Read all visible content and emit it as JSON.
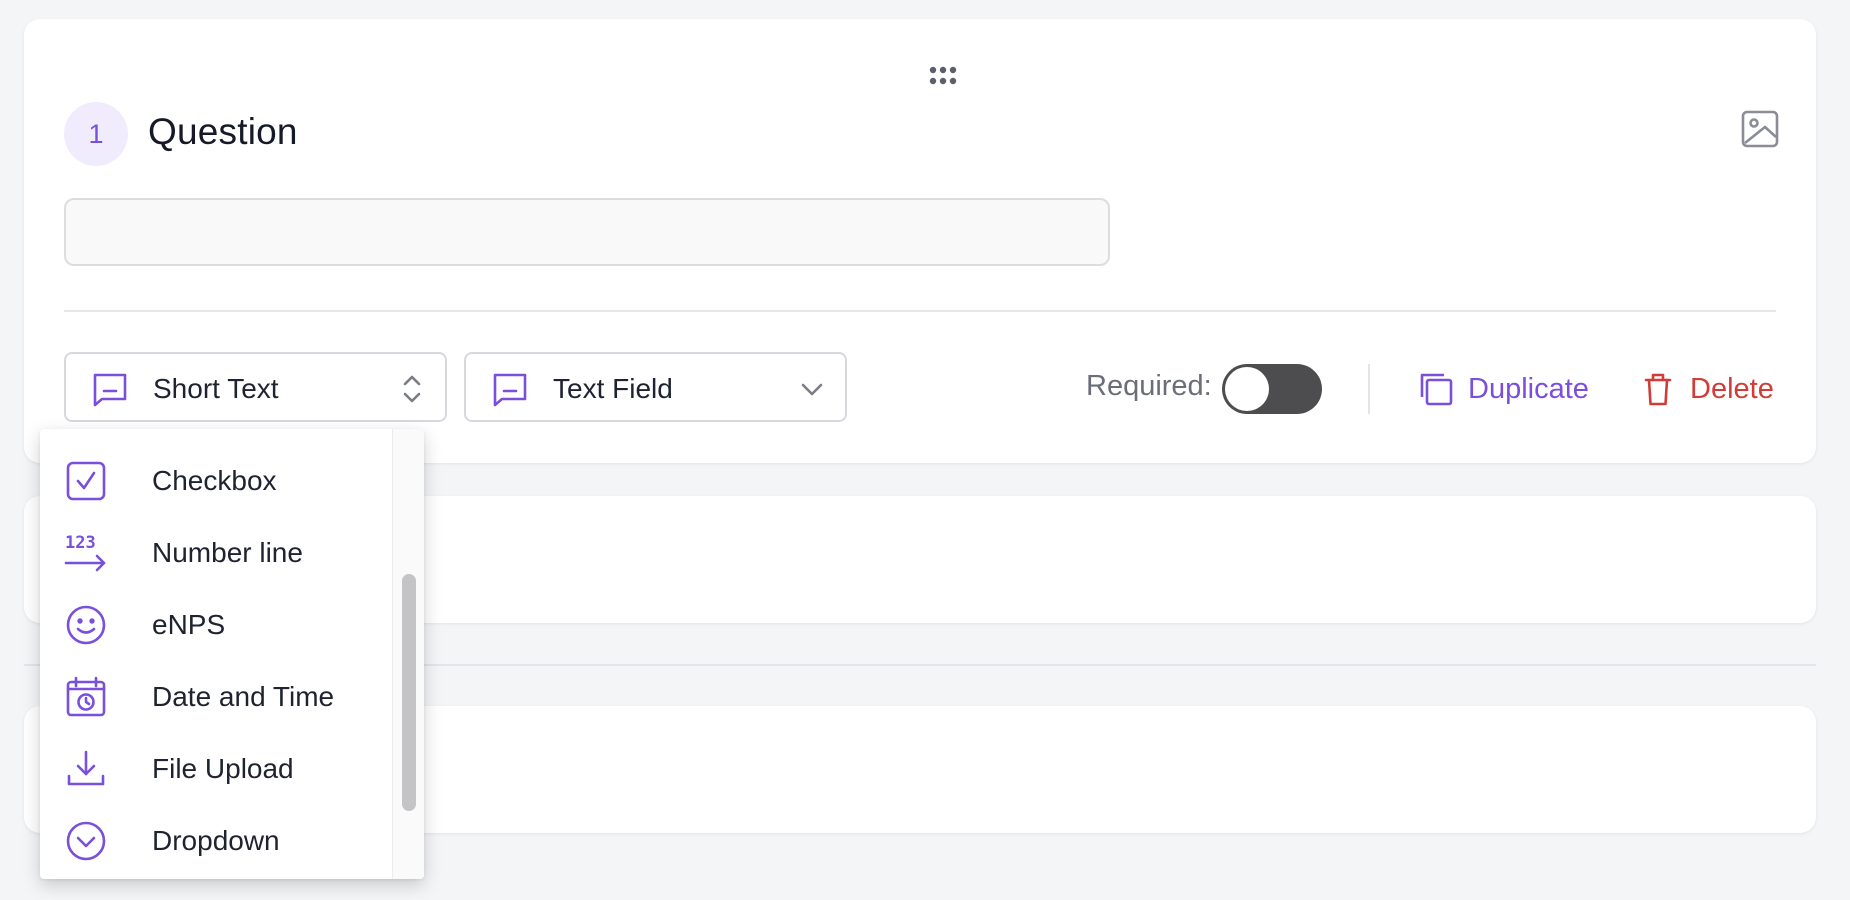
{
  "question": {
    "number": "1",
    "title": "Question",
    "input_value": "",
    "input_placeholder": ""
  },
  "type_select": {
    "value": "Short Text",
    "icon": "short-text-icon"
  },
  "format_select": {
    "value": "Text Field",
    "icon": "short-text-icon"
  },
  "required": {
    "label": "Required:",
    "enabled": false
  },
  "actions": {
    "duplicate_label": "Duplicate",
    "delete_label": "Delete"
  },
  "type_dropdown": {
    "items": [
      {
        "label": "Checkbox",
        "icon": "checkbox-icon"
      },
      {
        "label": "Number line",
        "icon": "number-line-icon"
      },
      {
        "label": "eNPS",
        "icon": "smiley-icon"
      },
      {
        "label": "Date and Time",
        "icon": "calendar-clock-icon"
      },
      {
        "label": "File Upload",
        "icon": "download-icon"
      },
      {
        "label": "Dropdown",
        "icon": "chevron-circle-icon"
      }
    ]
  },
  "colors": {
    "accent": "#7a4fdc",
    "danger": "#d23c36",
    "toggle_off": "#4d4d4f",
    "page_bg": "#f4f5f7"
  }
}
